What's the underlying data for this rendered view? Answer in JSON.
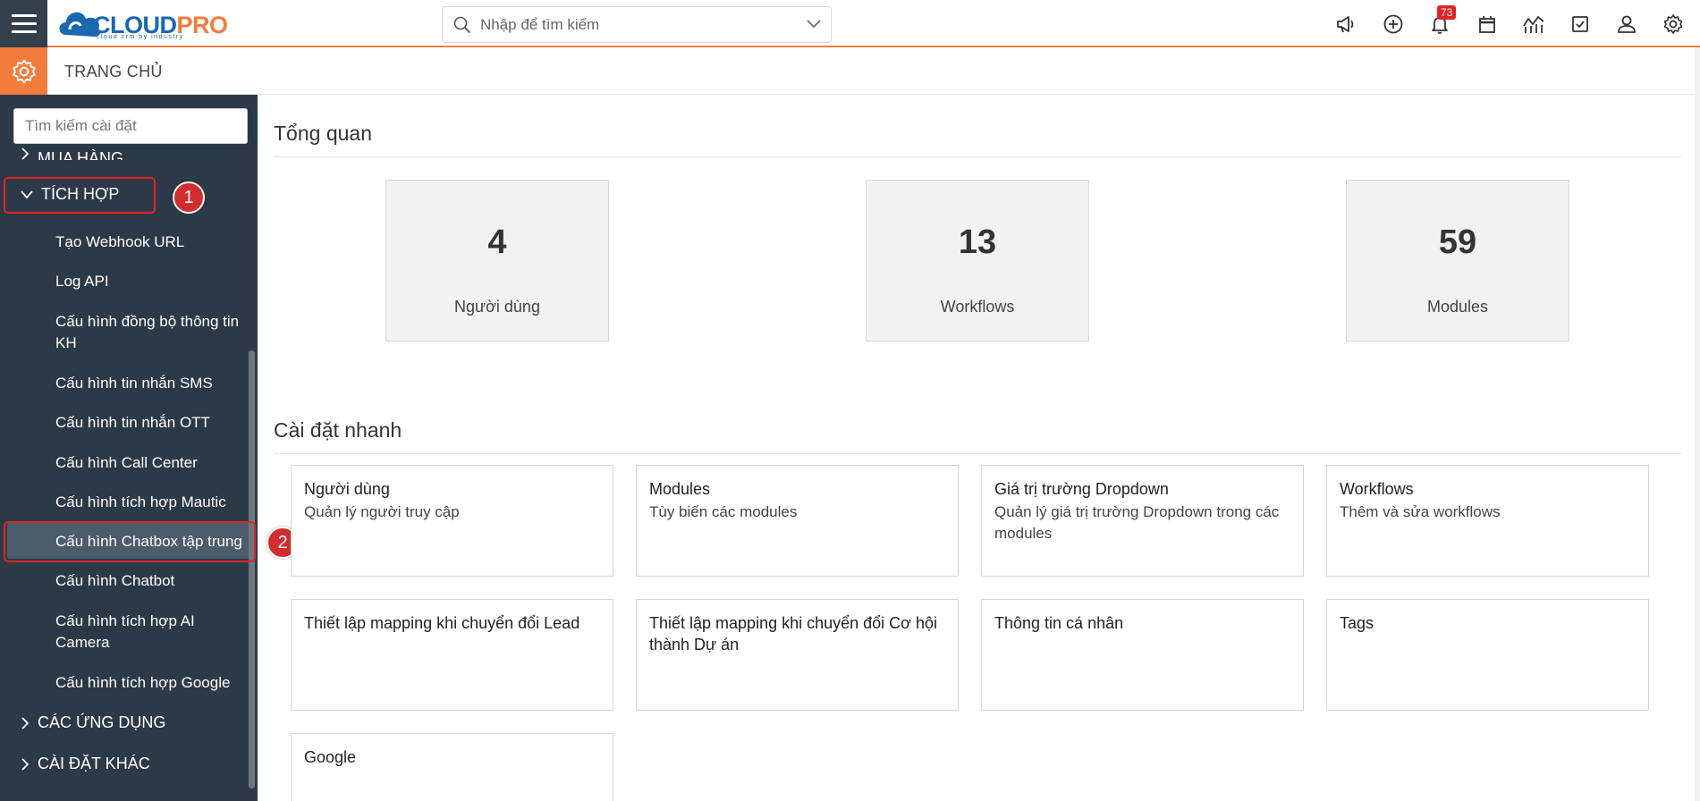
{
  "app": {
    "logo_text_a": "CLOUD",
    "logo_text_b": "PRO",
    "logo_tagline": "cloud crm by industry"
  },
  "search": {
    "placeholder": "Nhập để tìm kiếm"
  },
  "topbar": {
    "notification_count": "73"
  },
  "subbar": {
    "title": "TRANG CHỦ"
  },
  "sidebar": {
    "search_placeholder": "Tìm kiếm cài đặt",
    "partial_head": "MUA HÀNG",
    "integration_head": "TÍCH HỢP",
    "items": [
      "Tạo Webhook URL",
      "Log API",
      "Cấu hình đồng bộ thông tin KH",
      "Cấu hình tin nhắn SMS",
      "Cấu hình tin nhắn OTT",
      "Cấu hình Call Center",
      "Cấu hình tích hợp Mautic",
      "Cấu hình Chatbox tập trung",
      "Cấu hình Chatbot",
      "Cấu hình tích hợp AI Camera",
      "Cấu hình tích hợp Google"
    ],
    "apps_head": "CÁC ỨNG DỤNG",
    "other_head": "CÀI ĐẶT KHÁC"
  },
  "annotations": {
    "step1": "1",
    "step2": "2"
  },
  "overview": {
    "title": "Tổng quan",
    "stats": [
      {
        "value": "4",
        "label": "Người dùng"
      },
      {
        "value": "13",
        "label": "Workflows"
      },
      {
        "value": "59",
        "label": "Modules"
      }
    ]
  },
  "quick": {
    "title": "Cài đặt nhanh",
    "cards": [
      {
        "title": "Người dùng",
        "desc": "Quản lý người truy cập"
      },
      {
        "title": "Modules",
        "desc": "Tùy biến các modules"
      },
      {
        "title": "Giá trị trường Dropdown",
        "desc": "Quản lý giá trị trường Dropdown trong các modules"
      },
      {
        "title": "Workflows",
        "desc": "Thêm và sửa workflows"
      },
      {
        "title": "Thiết lập mapping khi chuyển đổi Lead",
        "desc": ""
      },
      {
        "title": "Thiết lập mapping khi chuyển đổi Cơ hội thành Dự án",
        "desc": ""
      },
      {
        "title": "Thông tin cá nhân",
        "desc": ""
      },
      {
        "title": "Tags",
        "desc": ""
      },
      {
        "title": "Google",
        "desc": ""
      }
    ]
  },
  "colors": {
    "accent": "#f47c3c",
    "sidebar": "#2c3a47",
    "brand_blue": "#1a67b2",
    "annotation_red": "#e02424"
  }
}
